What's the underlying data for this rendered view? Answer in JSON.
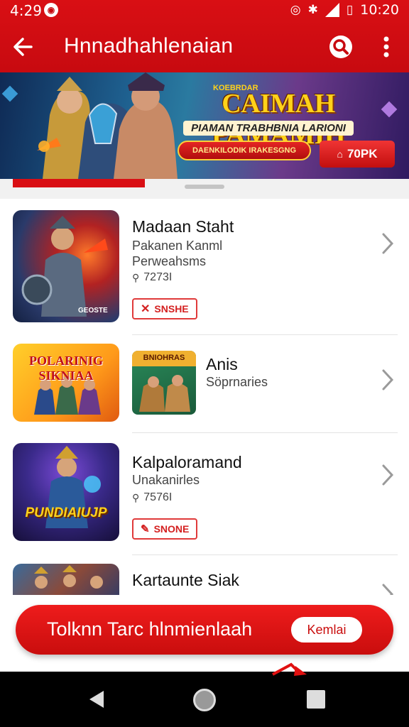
{
  "status": {
    "time": "4:29",
    "clock": "10:20"
  },
  "appbar": {
    "title": "Hnnadhahlenaian"
  },
  "banner": {
    "top_line": "KOEBRDAR",
    "title": "CAIMAH PAMAMIH",
    "subtitle": "PIAMAN TRABHBNIA LARIONI",
    "pill_text": "DAENKILODIK IRAKESGNG",
    "button_label": "70PK",
    "colors": {
      "accent": "#d90f14",
      "gold": "#ffd21a"
    }
  },
  "list": [
    {
      "title": "Madaan Staht",
      "subtitle": "Pakanen Kanml",
      "extra": "Perweahsms",
      "meta": "7273I",
      "tag": "SNSHE",
      "tag_icon": "close-icon",
      "thumb_caption": "GEOSTE"
    },
    {
      "title": "Anis",
      "subtitle": "Söprnaries",
      "thumb_left": "POLARINIG SIKNIAA",
      "thumb_right": "BNIOHRAS"
    },
    {
      "title": "Kalpaloramand",
      "subtitle": "Unakanirles",
      "meta": "7576I",
      "tag": "SNONE",
      "tag_icon": "pencil-icon",
      "thumb_caption": "PUNDIAIUJP"
    },
    {
      "title": "Kartaunte Siak"
    }
  ],
  "cta": {
    "label": "Tolknn Tarc hlnmienlaah",
    "pill": "Kemlai"
  }
}
